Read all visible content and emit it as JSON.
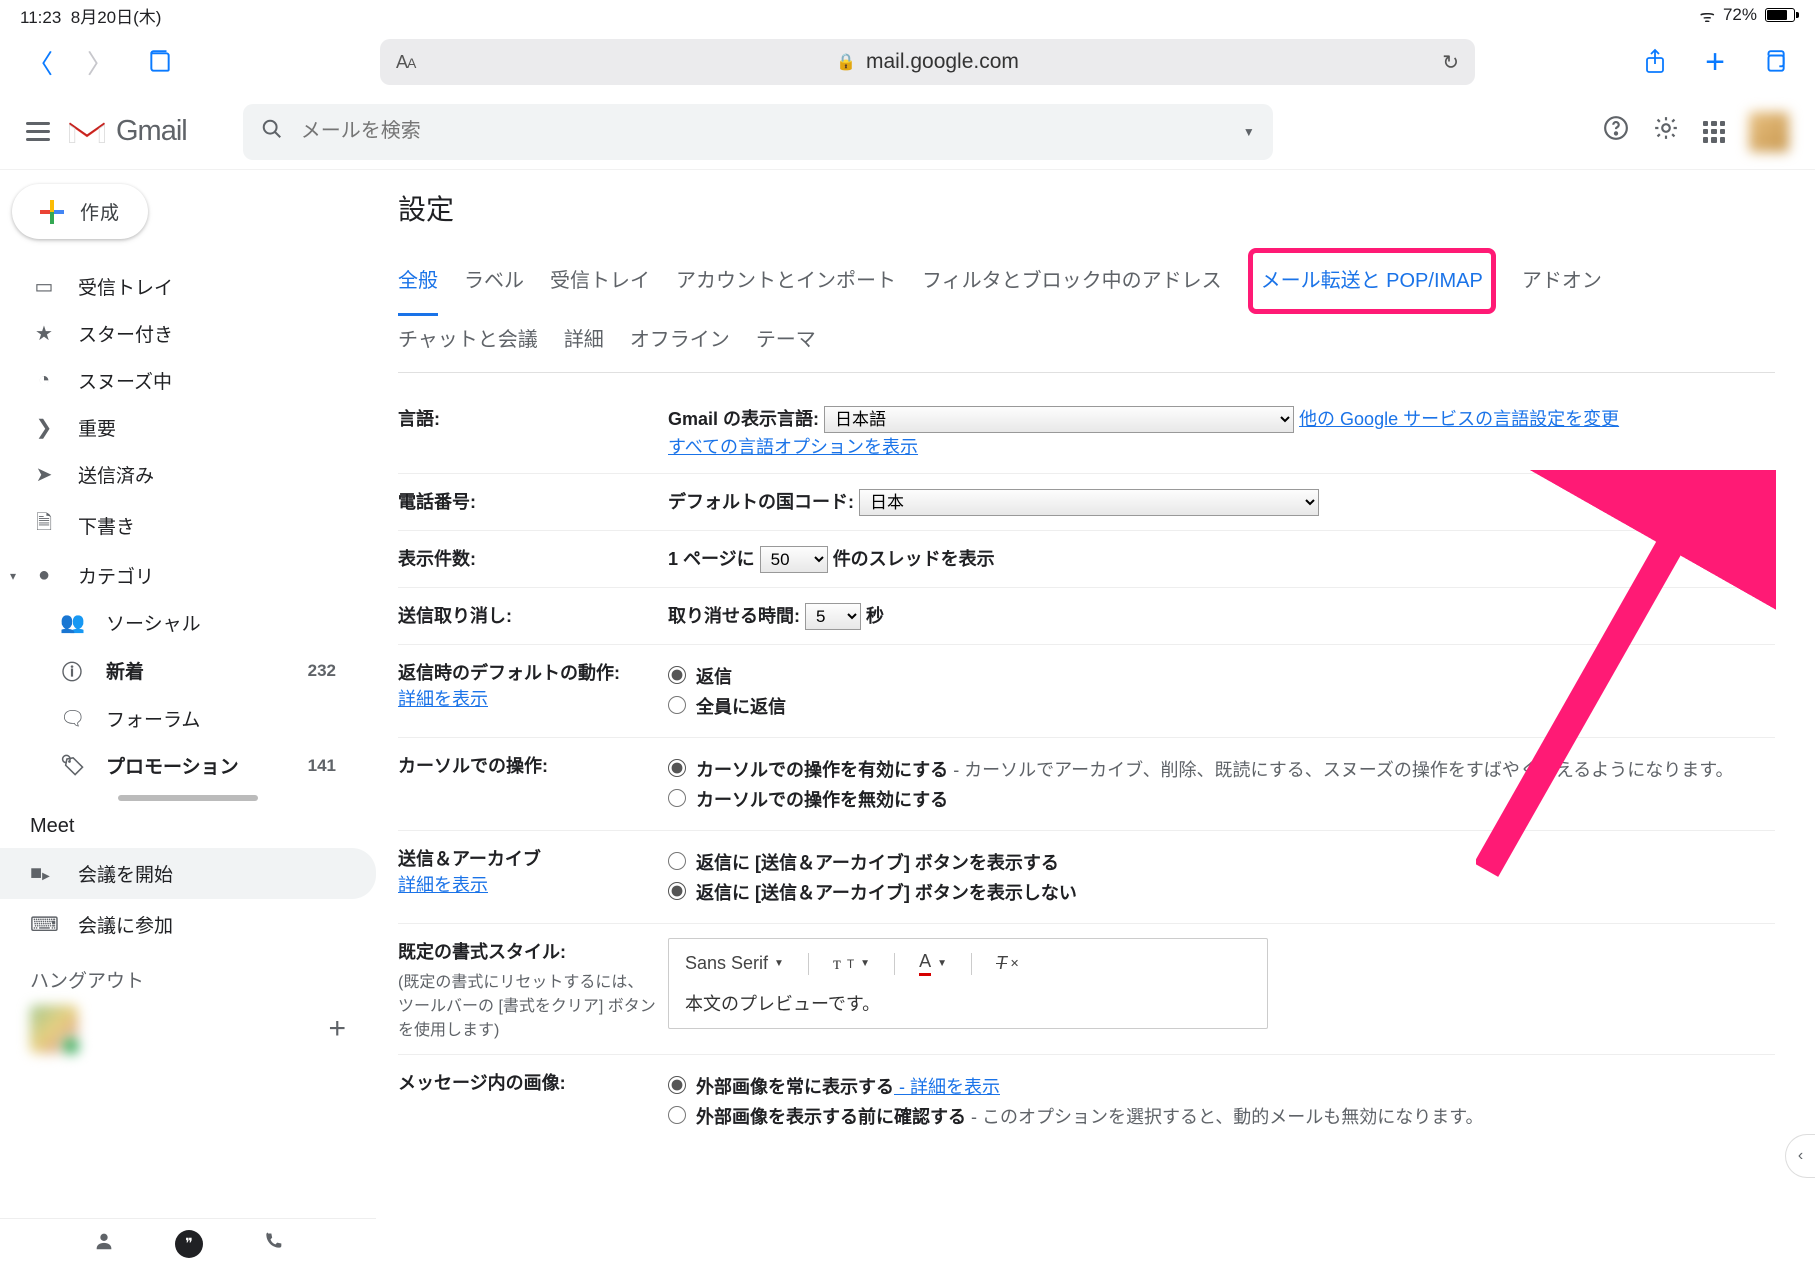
{
  "ios_status": {
    "time": "11:23",
    "date": "8月20日(木)",
    "battery_percent": "72%"
  },
  "safari": {
    "url_host": "mail.google.com"
  },
  "gmail_header": {
    "logo_text": "Gmail",
    "search_placeholder": "メールを検索"
  },
  "compose_label": "作成",
  "sidebar": {
    "items": [
      {
        "icon": "▭",
        "label": "受信トレイ"
      },
      {
        "icon": "★",
        "label": "スター付き"
      },
      {
        "icon": "◔",
        "label": "スヌーズ中"
      },
      {
        "icon": "❯",
        "label": "重要"
      },
      {
        "icon": "➤",
        "label": "送信済み"
      },
      {
        "icon": "🗎",
        "label": "下書き"
      },
      {
        "icon": "●",
        "label": "カテゴリ",
        "expandable": true
      },
      {
        "icon": "👥",
        "label": "ソーシャル",
        "sub": true
      },
      {
        "icon": "ⓘ",
        "label": "新着",
        "sub": true,
        "bold": true,
        "count": "232"
      },
      {
        "icon": "🗨",
        "label": "フォーラム",
        "sub": true
      },
      {
        "icon": "🏷",
        "label": "プロモーション",
        "sub": true,
        "bold": true,
        "count": "141"
      }
    ]
  },
  "meet": {
    "title": "Meet",
    "start": "会議を開始",
    "join": "会議に参加"
  },
  "hangouts": {
    "title": "ハングアウト"
  },
  "settings_title": "設定",
  "tabs": [
    "全般",
    "ラベル",
    "受信トレイ",
    "アカウントとインポート",
    "フィルタとブロック中のアドレス",
    "メール転送と POP/IMAP",
    "アドオン",
    "チャットと会議",
    "詳細",
    "オフライン",
    "テーマ"
  ],
  "rows": {
    "language": {
      "label": "言語:",
      "display_label": "Gmail の表示言語:",
      "selected": "日本語",
      "other_link": "他の Google サービスの言語設定を変更",
      "show_all": "すべての言語オプションを表示"
    },
    "phone": {
      "label": "電話番号:",
      "default_code_label": "デフォルトの国コード:",
      "selected": "日本"
    },
    "page_size": {
      "label": "表示件数:",
      "prefix": "1 ページに",
      "value": "50",
      "suffix": "件のスレッドを表示"
    },
    "undo": {
      "label": "送信取り消し:",
      "prefix": "取り消せる時間:",
      "value": "5",
      "suffix": "秒"
    },
    "reply_default": {
      "label": "返信時のデフォルトの動作:",
      "detail_link": "詳細を表示",
      "opt1": "返信",
      "opt2": "全員に返信"
    },
    "hover": {
      "label": "カーソルでの操作:",
      "opt1": "カーソルでの操作を有効にする",
      "opt1_desc": " - カーソルでアーカイブ、削除、既読にする、スヌーズの操作をすばやく行えるようになります。",
      "opt2": "カーソルでの操作を無効にする"
    },
    "send_archive": {
      "label": "送信＆アーカイブ",
      "detail_link": "詳細を表示",
      "opt1": "返信に [送信＆アーカイブ] ボタンを表示する",
      "opt2": "返信に [送信＆アーカイブ] ボタンを表示しない"
    },
    "default_style": {
      "label": "既定の書式スタイル:",
      "sublabel": "(既定の書式にリセットするには、ツールバーの [書式をクリア] ボタンを使用します)",
      "font_name": "Sans Serif",
      "preview_text": "本文のプレビューです。"
    },
    "images": {
      "label": "メッセージ内の画像:",
      "opt1": "外部画像を常に表示する",
      "opt1_link": " - 詳細を表示",
      "opt2": "外部画像を表示する前に確認する",
      "opt2_desc": " - このオプションを選択すると、動的メールも無効になります。"
    }
  }
}
